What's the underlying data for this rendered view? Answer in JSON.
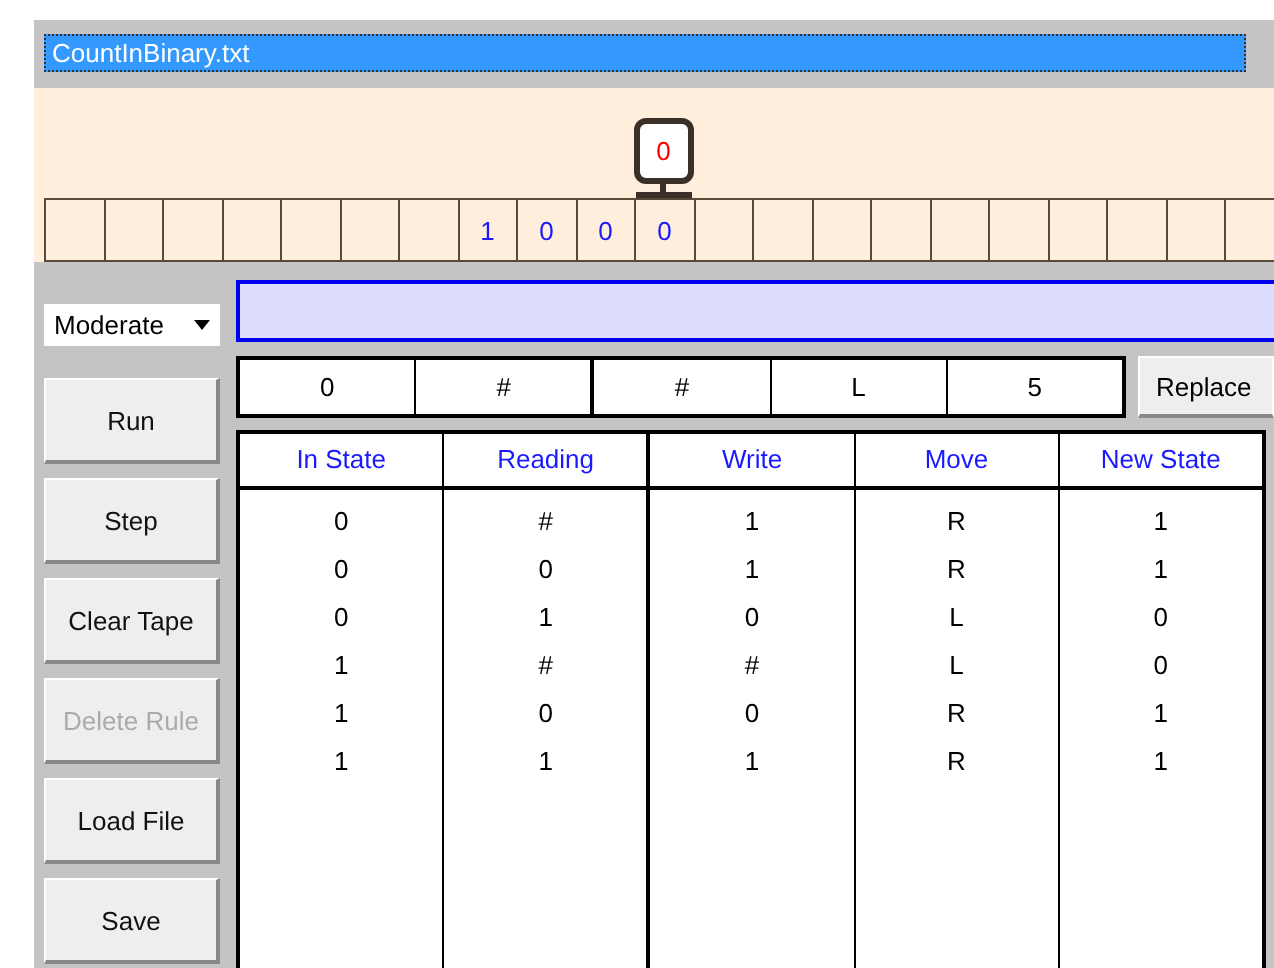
{
  "file_name": "CountInBinary.txt",
  "head_state": "0",
  "tape": [
    {
      "selected": false
    },
    {
      "selected": false
    },
    {
      "selected": false
    },
    {
      "selected": false
    },
    {
      "selected": false
    },
    {
      "selected": false
    },
    {
      "selected": false
    },
    {
      "symbol": "1",
      "selected": false
    },
    {
      "symbol": "0",
      "selected": false
    },
    {
      "symbol": "0",
      "selected": false
    },
    {
      "symbol": "0",
      "selected": true
    },
    {
      "selected": false
    },
    {
      "selected": false
    },
    {
      "selected": false
    },
    {
      "selected": false
    },
    {
      "selected": false
    },
    {
      "selected": false
    },
    {
      "selected": false
    },
    {
      "selected": false
    },
    {
      "selected": false
    },
    {
      "selected": false
    }
  ],
  "speed": "Moderate",
  "buttons": [
    {
      "label": "Run",
      "disabled": false
    },
    {
      "label": "Step",
      "disabled": false
    },
    {
      "label": "Clear Tape",
      "disabled": false
    },
    {
      "label": "Delete Rule",
      "disabled": true
    },
    {
      "label": "Load File",
      "disabled": false
    },
    {
      "label": "Save",
      "disabled": false
    }
  ],
  "rule_editor": [
    "0",
    "#",
    "#",
    "L",
    "5"
  ],
  "replace_button": "Replace",
  "table": {
    "columns": [
      "In State",
      "Reading",
      "Write",
      "Move",
      "New State"
    ],
    "rows": [
      [
        "0",
        "#",
        "1",
        "R",
        "1"
      ],
      [
        "0",
        "0",
        "1",
        "R",
        "1"
      ],
      [
        "0",
        "1",
        "0",
        "L",
        "0"
      ],
      [
        "1",
        "#",
        "#",
        "L",
        "0"
      ],
      [
        "1",
        "0",
        "0",
        "R",
        "1"
      ],
      [
        "1",
        "1",
        "1",
        "R",
        "1"
      ]
    ]
  }
}
